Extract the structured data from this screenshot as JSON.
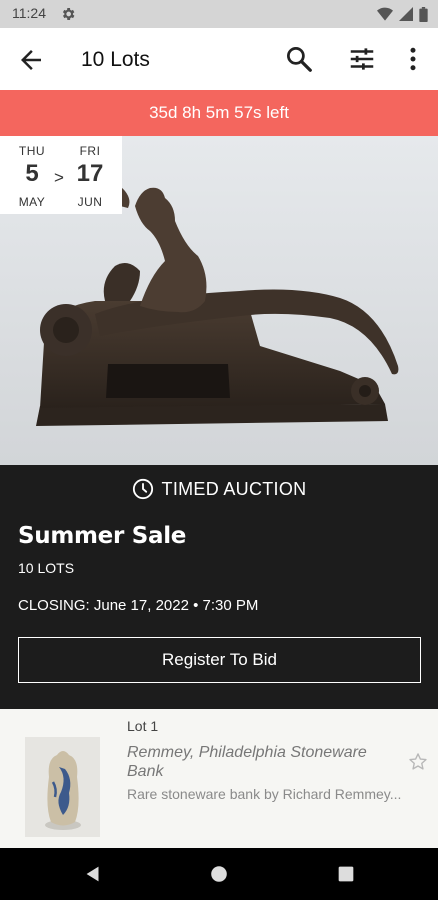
{
  "status_bar": {
    "time": "11:24",
    "icons": [
      "gear-icon",
      "wifi-icon",
      "signal-icon",
      "battery-icon"
    ]
  },
  "app_bar": {
    "title": "10 Lots",
    "icons": [
      "back-arrow-icon",
      "search-icon",
      "filter-sliders-icon",
      "more-vert-icon"
    ]
  },
  "countdown": {
    "text": "35d 8h 5m 57s left",
    "color": "#f4665e"
  },
  "date_range": {
    "start": {
      "dow": "THU",
      "day": "5",
      "month": "MAY"
    },
    "separator": ">",
    "end": {
      "dow": "FRI",
      "day": "17",
      "month": "JUN"
    }
  },
  "auction": {
    "type": "TIMED AUCTION",
    "title": "Summer Sale",
    "lots_count": "10 LOTS",
    "closing": "CLOSING: June 17, 2022 • 7:30 PM",
    "register_label": "Register To Bid"
  },
  "lots": [
    {
      "number": "Lot 1",
      "title": "Remmey, Philadelphia Stoneware Bank",
      "description": "Rare stoneware bank by Richard Remmey...",
      "icon": "star-outline-icon"
    }
  ],
  "nav_bar": {
    "icons": [
      "back-triangle-icon",
      "home-circle-icon",
      "recents-square-icon"
    ]
  }
}
